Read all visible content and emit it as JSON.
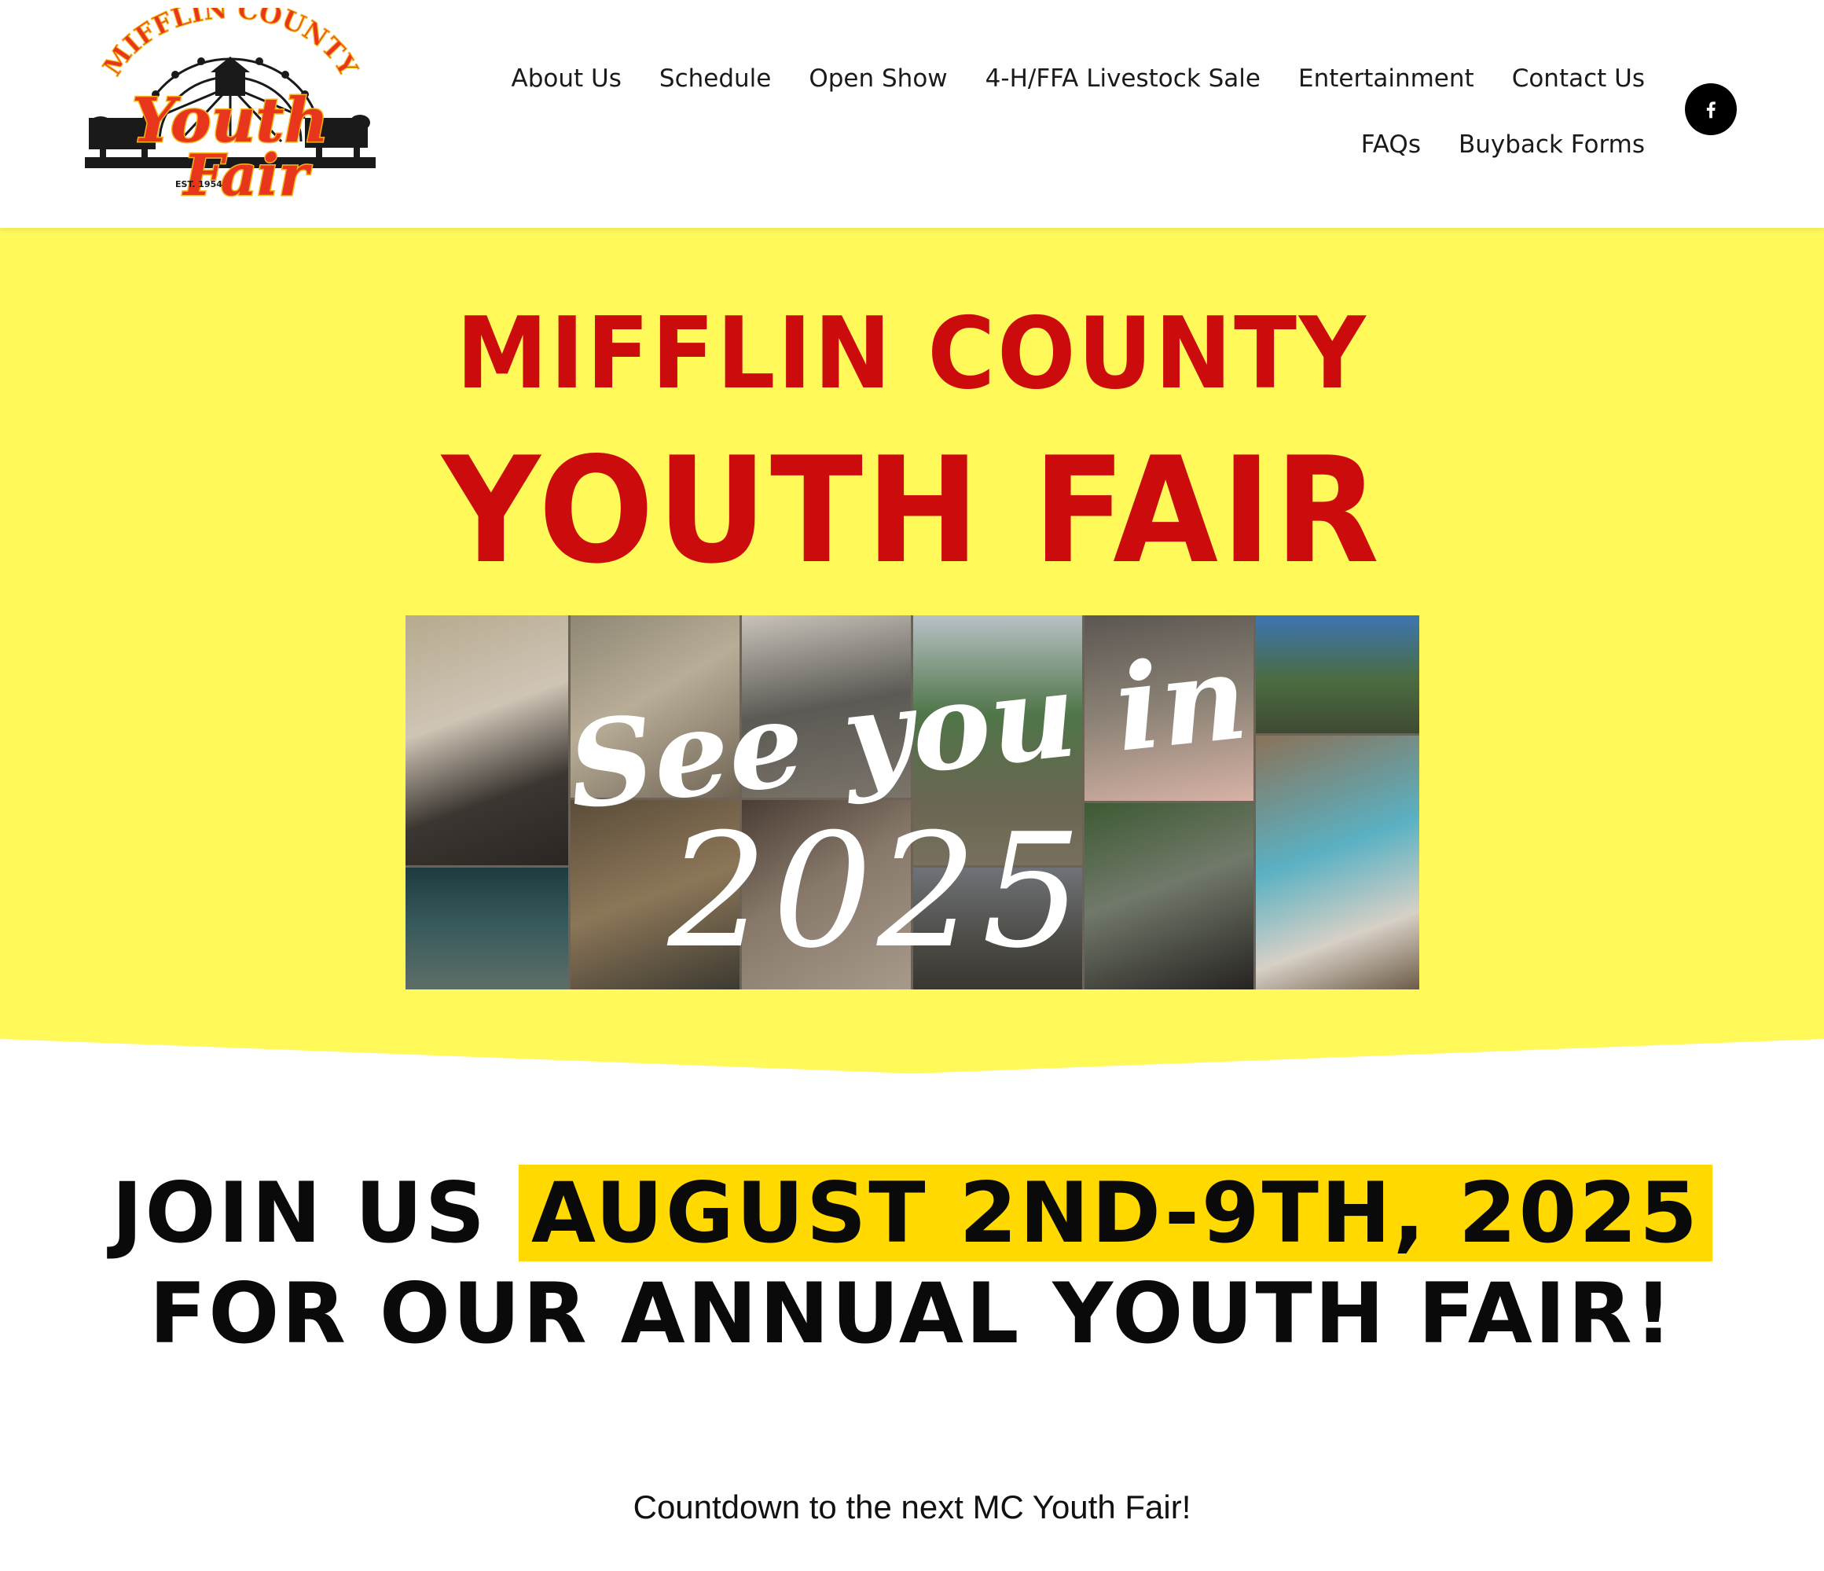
{
  "header": {
    "logo": {
      "top_text": "MIFFLIN COUNTY",
      "script_text_1": "Youth",
      "script_text_2": "Fair",
      "established": "EST. 1954"
    },
    "nav": [
      {
        "label": "About Us"
      },
      {
        "label": "Schedule"
      },
      {
        "label": "Open Show"
      },
      {
        "label": "4-H/FFA Livestock Sale"
      },
      {
        "label": "Entertainment"
      },
      {
        "label": "Contact Us"
      },
      {
        "label": "FAQs"
      },
      {
        "label": "Buyback Forms"
      }
    ],
    "social": {
      "icon": "facebook-icon"
    }
  },
  "hero": {
    "title_line1": "MIFFLIN COUNTY",
    "title_line2": "YOUTH FAIR",
    "collage_script_text": "See you in",
    "collage_year_text": "2025",
    "colors": {
      "background": "#fff95a",
      "title": "#cc0c0c"
    }
  },
  "event": {
    "lead": "JOIN US",
    "dates": "AUGUST 2ND-9TH, 2025",
    "line2": "FOR OUR ANNUAL YOUTH FAIR!",
    "highlight_color": "#ffd900"
  },
  "countdown": {
    "text": "Countdown to the next MC Youth Fair!"
  }
}
